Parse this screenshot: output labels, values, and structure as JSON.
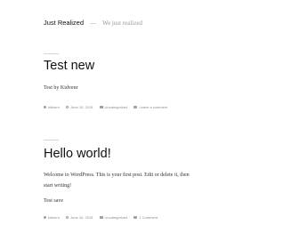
{
  "site": {
    "title": "Just Realized",
    "separator": "—",
    "description": "We just realized"
  },
  "posts": [
    {
      "title": "Test new",
      "paragraphs": [
        "Test by Kidvenr"
      ],
      "meta": {
        "author": "kidvenr",
        "date": "June 10, 2019",
        "category": "Uncategorized",
        "comments": "Leave a comment"
      }
    },
    {
      "title": "Hello world!",
      "paragraphs": [
        "Welcome to WordPress. This is your first post. Edit or delete it, then",
        "start writing!",
        "Test save"
      ],
      "meta": {
        "author": "kidvenr",
        "date": "June 10, 2019",
        "category": "Uncategorized",
        "comments": "1 Comment"
      }
    }
  ],
  "icons": {
    "author": "user-icon",
    "date": "clock-icon",
    "category": "folder-icon",
    "comments": "comment-icon"
  },
  "colors": {
    "text": "#333333",
    "title": "#111111",
    "muted": "#8c8c8c"
  }
}
